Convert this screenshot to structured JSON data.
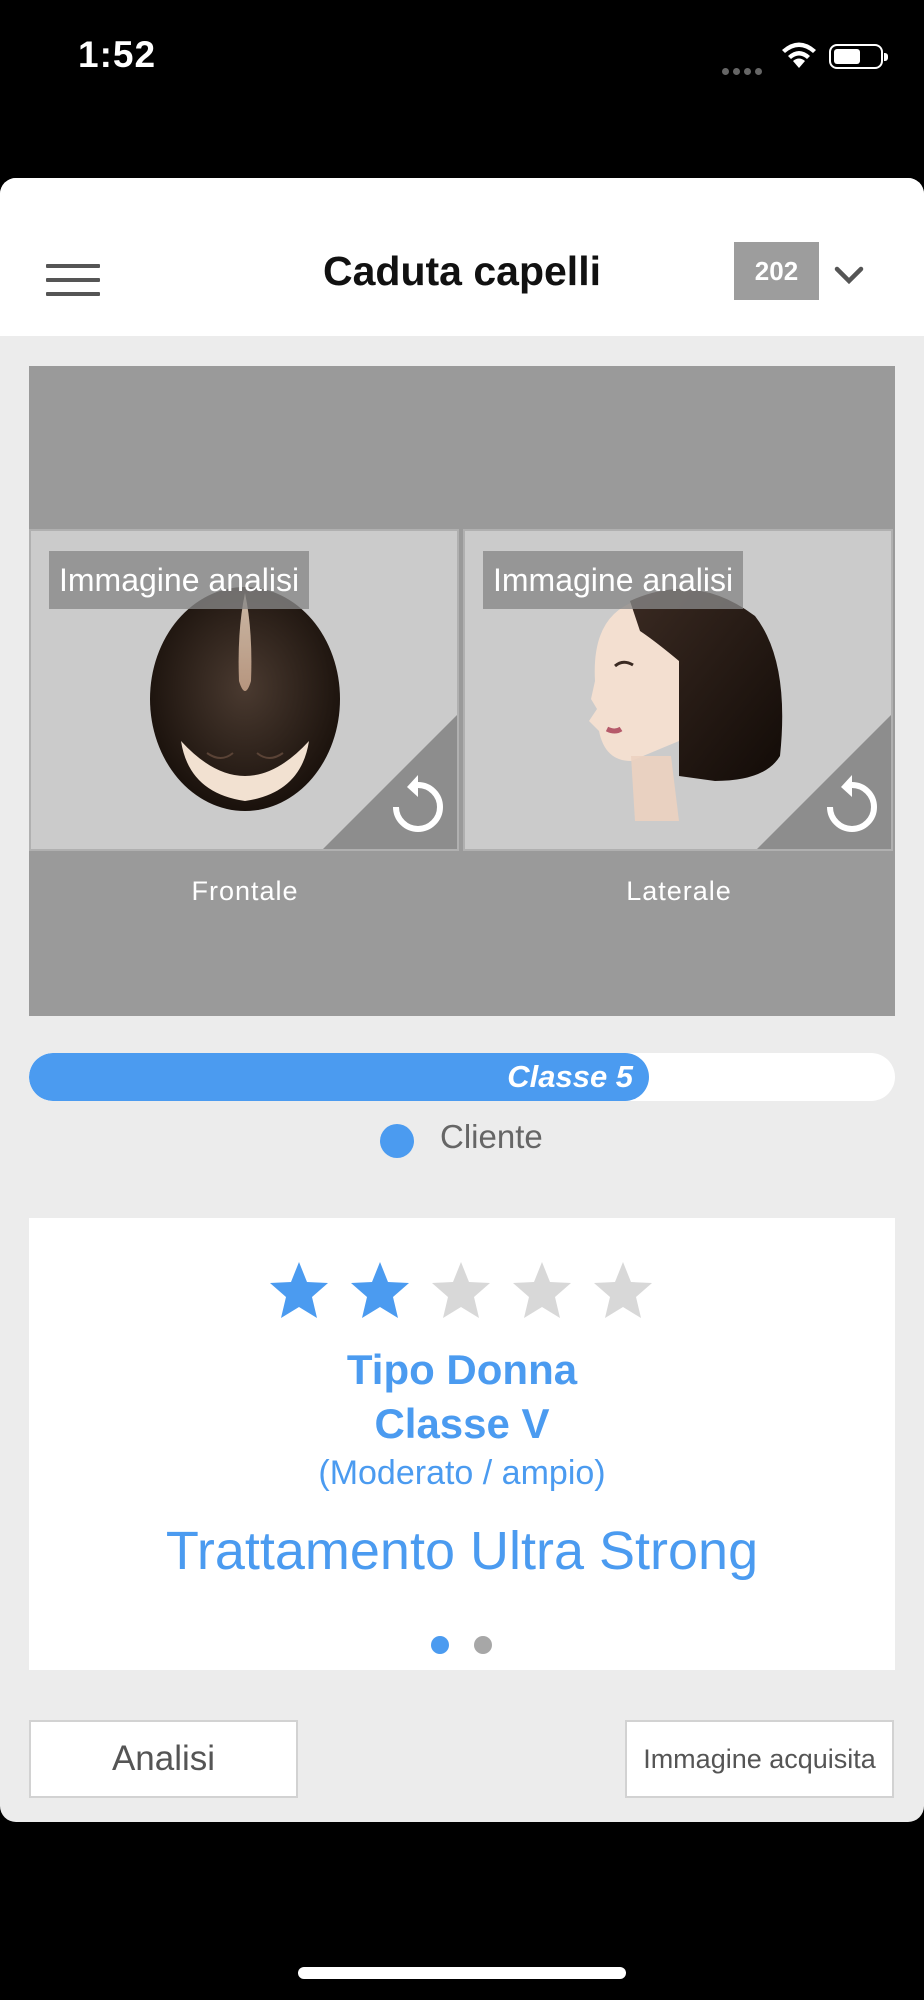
{
  "status_bar": {
    "time": "1:52"
  },
  "header": {
    "title": "Caduta capelli",
    "code": "202"
  },
  "images": [
    {
      "tag": "Immagine analisi",
      "caption": "Frontale"
    },
    {
      "tag": "Immagine analisi",
      "caption": "Laterale"
    }
  ],
  "progress": {
    "label": "Classe 5",
    "value_fraction": 0.716,
    "color": "#4b9bf0"
  },
  "legend": {
    "label": "Cliente"
  },
  "result": {
    "rating": 2,
    "rating_max": 5,
    "type": "Tipo Donna",
    "class": "Classe V",
    "description": "(Moderato / ampio)",
    "treatment": "Trattamento Ultra Strong",
    "page_current": 1,
    "page_count": 2
  },
  "buttons": {
    "left": "Analisi",
    "right": "Immagine acquisita"
  },
  "colors": {
    "accent": "#4b9bf0",
    "star_off": "#d8d8d8",
    "panel": "#9a9a9a"
  }
}
